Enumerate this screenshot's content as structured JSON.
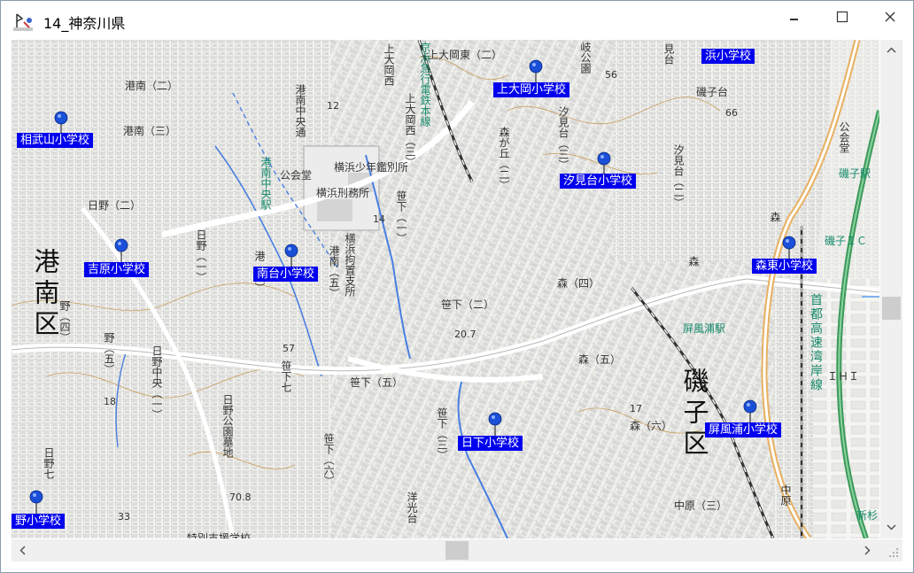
{
  "window": {
    "title": "14_神奈川県",
    "controls": {
      "minimize": "minimize",
      "maximize": "maximize",
      "close": "close"
    }
  },
  "map": {
    "wards": [
      {
        "id": "konan",
        "text": "港南区"
      },
      {
        "id": "isogo",
        "text": "磯子区"
      }
    ],
    "schools": [
      {
        "id": "soubuyama",
        "name": "相武山小学校"
      },
      {
        "id": "kamiooka",
        "name": "上大岡小学校"
      },
      {
        "id": "hama",
        "name": "浜小学校"
      },
      {
        "id": "shiomidai",
        "name": "汐見台小学校"
      },
      {
        "id": "yoshiwara",
        "name": "吉原小学校"
      },
      {
        "id": "minamidai",
        "name": "南台小学校"
      },
      {
        "id": "morihigashi",
        "name": "森東小学校"
      },
      {
        "id": "hikage",
        "name": "日下小学校"
      },
      {
        "id": "byobugaura",
        "name": "屏風浦小学校"
      },
      {
        "id": "hino",
        "name": "野小学校"
      }
    ],
    "places": [
      {
        "id": "p_minami2",
        "text": "港南（二）"
      },
      {
        "id": "p_minami3",
        "text": "港南（三）"
      },
      {
        "id": "p_hino2",
        "text": "日野（二）"
      },
      {
        "id": "p_kamiookahigashi2",
        "text": "上大岡東（二）"
      },
      {
        "id": "p_mori4",
        "text": "森（四）"
      },
      {
        "id": "p_mori5",
        "text": "森（五）"
      },
      {
        "id": "p_sasashita2",
        "text": "笹下（二）"
      },
      {
        "id": "p_sasashita5",
        "text": "笹下（五）"
      },
      {
        "id": "p_mori6",
        "text": "森（六）"
      },
      {
        "id": "p_nakahara3",
        "text": "中原（三）"
      },
      {
        "id": "p_isogodai",
        "text": "磯子台"
      },
      {
        "id": "p_kokaido",
        "text": "公会堂"
      },
      {
        "id": "p_shonen",
        "text": "横浜少年鑑別所"
      },
      {
        "id": "p_keimu",
        "text": "横浜刑務所"
      },
      {
        "id": "p_byobu_st",
        "text": "屏風浦駅"
      },
      {
        "id": "p_isogo_ic",
        "text": "磯子ＩＣ"
      },
      {
        "id": "p_isogo_st",
        "text": "磯子駅"
      },
      {
        "id": "p_tokubetsu",
        "text": "特別支援学校"
      },
      {
        "id": "p_ihi",
        "text": "ＩＨＩ"
      },
      {
        "id": "p_shinsugita",
        "text": "新杉"
      },
      {
        "id": "v_kamiooka_nishi",
        "text": "上大岡西（三）"
      },
      {
        "id": "v_kamiooka_nishi_top",
        "text": "上大岡西"
      },
      {
        "id": "v_konan_chuo",
        "text": "港南中央通"
      },
      {
        "id": "v_konan_chuo_st",
        "text": "港南中央駅"
      },
      {
        "id": "v_morigaoka",
        "text": "森が丘（二）"
      },
      {
        "id": "v_shiomidai",
        "text": "汐見台（三）"
      },
      {
        "id": "v_shiomidai2",
        "text": "汐見台（二）"
      },
      {
        "id": "v_sasashita_1",
        "text": "笹下（一）"
      },
      {
        "id": "v_sasashita_7",
        "text": "笹下七"
      },
      {
        "id": "v_sasashita_6",
        "text": "笹下（六）"
      },
      {
        "id": "v_sasashita_3",
        "text": "笹下（三）"
      },
      {
        "id": "v_hino_chuo",
        "text": "日野中央（一）"
      },
      {
        "id": "v_hino_koen",
        "text": "日野公園墓地"
      },
      {
        "id": "v_hino1",
        "text": "日野（一）"
      },
      {
        "id": "v_hino4",
        "text": "野（四）"
      },
      {
        "id": "v_hino5",
        "text": "野（五）"
      },
      {
        "id": "v_hino7",
        "text": "日野七"
      },
      {
        "id": "v_konan5",
        "text": "港南（五）"
      },
      {
        "id": "v_konan6",
        "text": "港（六）"
      },
      {
        "id": "v_kochisho",
        "text": "横浜拘置支所"
      },
      {
        "id": "v_yoko",
        "text": "洋光台"
      },
      {
        "id": "v_nakahara",
        "text": "中原"
      },
      {
        "id": "v_mori_small",
        "text": "森"
      },
      {
        "id": "v_mori_small2",
        "text": "森"
      },
      {
        "id": "v_shuto",
        "text": "首都高速湾岸線"
      },
      {
        "id": "v_keikyu",
        "text": "京浜急行電鉄本線"
      },
      {
        "id": "v_kokaido_r",
        "text": "公会堂"
      },
      {
        "id": "v_mihami",
        "text": "見台"
      },
      {
        "id": "v_gakikoen",
        "text": "岐公園"
      }
    ],
    "elevations": [
      "56",
      "66",
      "12",
      "14",
      "57",
      "17",
      "18",
      "20.7",
      "70.8",
      "33"
    ]
  }
}
